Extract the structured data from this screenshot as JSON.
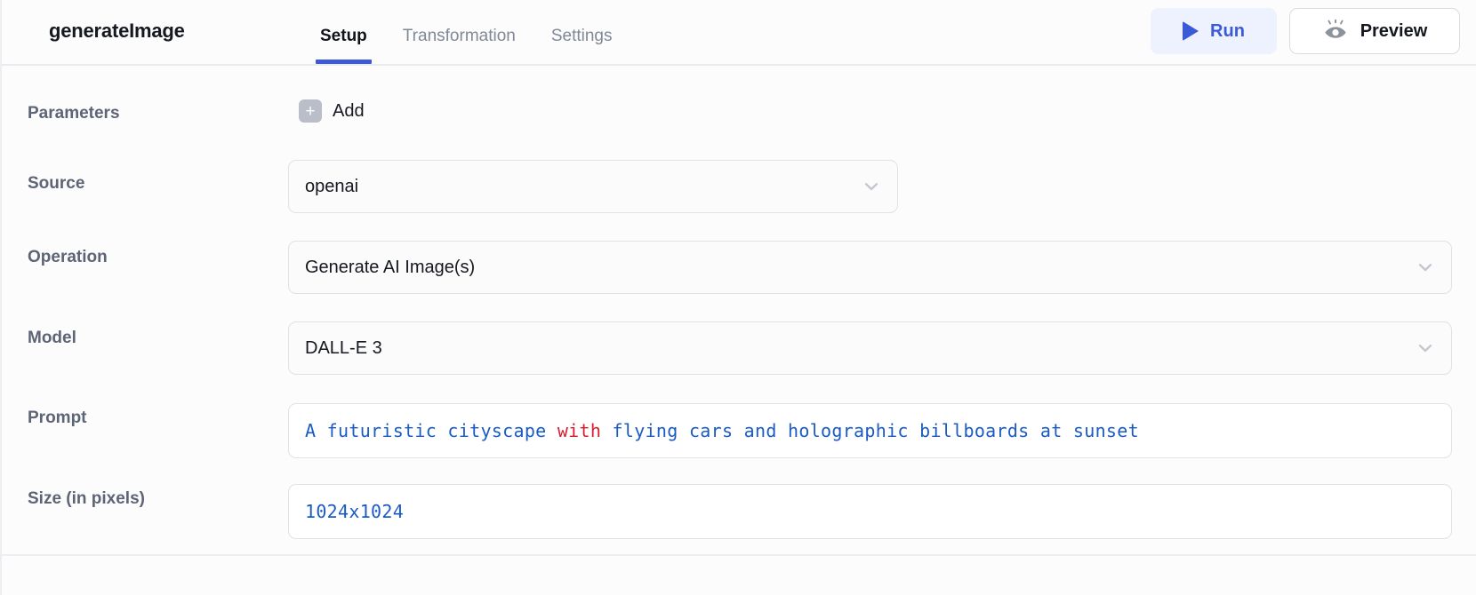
{
  "header": {
    "node_title": "generateImage",
    "tabs": [
      {
        "label": "Setup",
        "active": true
      },
      {
        "label": "Transformation",
        "active": false
      },
      {
        "label": "Settings",
        "active": false
      }
    ],
    "actions": {
      "run_label": "Run",
      "run_icon": "play-icon",
      "preview_label": "Preview",
      "preview_icon": "eye-icon"
    }
  },
  "form": {
    "parameters": {
      "label": "Parameters",
      "add_label": "Add",
      "add_icon": "plus-icon"
    },
    "source": {
      "label": "Source",
      "value": "openai",
      "icon": "chevron-down-icon"
    },
    "operation": {
      "label": "Operation",
      "value": "Generate AI Image(s)",
      "icon": "chevron-down-icon"
    },
    "model": {
      "label": "Model",
      "value": "DALL-E 3",
      "icon": "chevron-down-icon"
    },
    "prompt": {
      "label": "Prompt",
      "value": "A futuristic cityscape with flying cars and holographic billboards at sunset",
      "tokens": [
        {
          "text": "A futuristic cityscape ",
          "kind": "text"
        },
        {
          "text": "with",
          "kind": "keyword"
        },
        {
          "text": " flying cars and holographic billboards at sunset",
          "kind": "text"
        }
      ]
    },
    "size": {
      "label": "Size (in pixels)",
      "value": "1024x1024"
    }
  },
  "colors": {
    "accent_blue": "#3c5ad6",
    "run_bg": "#eef1fe",
    "code_blue": "#1a5bc4",
    "code_keyword_red": "#d32030",
    "label_gray": "#5d6475",
    "border_gray": "#dfe2e8"
  }
}
